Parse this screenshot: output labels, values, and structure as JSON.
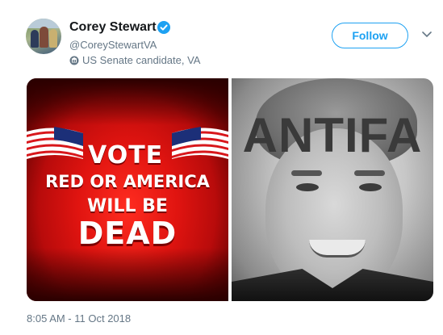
{
  "author": {
    "name": "Corey Stewart",
    "handle": "@CoreyStewartVA",
    "bio": "US Senate candidate, VA",
    "verified": true
  },
  "actions": {
    "follow_label": "Follow"
  },
  "media": {
    "left_image": {
      "line1": "VOTE",
      "line2": "RED OR AMERICA",
      "line3": "WILL BE",
      "line4": "DEAD"
    },
    "right_image": {
      "overlay_text": "ANTIFA"
    }
  },
  "timestamp": "8:05 AM - 11 Oct 2018",
  "colors": {
    "accent": "#1da1f2",
    "name_text": "#14171a",
    "secondary_text": "#657786"
  },
  "icons": [
    "verified-badge-icon",
    "building-icon",
    "chevron-down-icon"
  ]
}
